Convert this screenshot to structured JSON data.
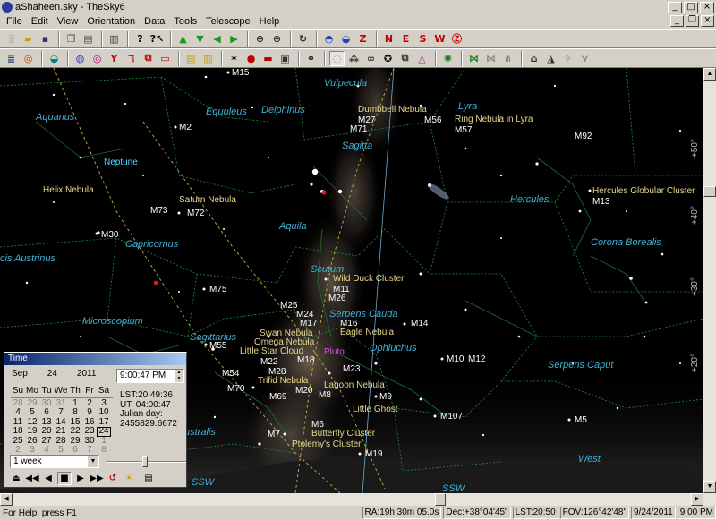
{
  "window": {
    "title": "aShaheen.sky - TheSky6"
  },
  "menu": [
    "File",
    "Edit",
    "View",
    "Orientation",
    "Data",
    "Tools",
    "Telescope",
    "Help"
  ],
  "toolbar1": [
    "📄",
    "📂",
    "💾",
    "▭",
    "▯",
    "🖶",
    "?",
    "?¶",
    "▲",
    "▼",
    "◀",
    "▶",
    "⊕",
    "⊖",
    "↻",
    "⛯",
    "⛰",
    "Z",
    "N",
    "E",
    "S",
    "W",
    "Z"
  ],
  "toolbar2": [
    "≣",
    "⊙",
    "◒",
    "◍",
    "◎",
    "Y",
    "ℸ",
    "□",
    "▤",
    "▥",
    "✶",
    "●",
    "▬",
    "⚭",
    "◌",
    "⁂",
    "∞",
    "✦",
    "⧉",
    "◬",
    "✺",
    "⋈",
    "⋔",
    "⌂",
    "◮",
    "✧",
    "⋎"
  ],
  "sky": {
    "constellations": [
      "Vulpecula",
      "Lyra",
      "Equuleus",
      "Delphinus",
      "Aquarius",
      "Sagitta",
      "Hercules",
      "Aquila",
      "Capricornus",
      "Corona Borealis",
      "cis Austrinus",
      "Scutum",
      "Serpens Cauda",
      "Microscopium",
      "Ophiuchus",
      "Sagittarius",
      "Serpens Caput",
      "ustralis"
    ],
    "objects": [
      "Dumbbell Nebula",
      "Ring Nebula in Lyra",
      "Helix Nebula",
      "Saturn Nebula",
      "Hercules Globular Cluster",
      "Wild Duck Cluster",
      "Eagle Nebula",
      "Swan Nebula",
      "Omega Nebula",
      "Little Star Cloud",
      "Trifid Nebula",
      "Lagoon Nebula",
      "Little Ghost",
      "Butterfly Cluster",
      "Ptolemy's Cluster"
    ],
    "messier": [
      "M15",
      "M2",
      "M27",
      "M56",
      "M71",
      "M57",
      "M92",
      "M73",
      "M72",
      "M30",
      "M13",
      "M75",
      "M11",
      "M26",
      "M25",
      "M24",
      "M17",
      "M16",
      "M14",
      "M55",
      "M18",
      "M23",
      "M22",
      "M28",
      "M10",
      "M12",
      "M54",
      "M20",
      "M8",
      "M70",
      "M69",
      "M9",
      "M107",
      "M7",
      "M6",
      "M5",
      "M19"
    ],
    "planets": [
      "Neptune",
      "Pluto"
    ],
    "directions": [
      "SSW",
      "SSW",
      "West"
    ],
    "altitudes": [
      "+50°",
      "+40°",
      "+30°",
      "+20°"
    ]
  },
  "time_window": {
    "title": "Time",
    "month": "Sep",
    "day": "24",
    "year": "2011",
    "weekdays": [
      "Su",
      "Mo",
      "Tu",
      "We",
      "Th",
      "Fr",
      "Sa"
    ],
    "weeks": [
      [
        "28",
        "29",
        "30",
        "31",
        "1",
        "2",
        "3"
      ],
      [
        "4",
        "5",
        "6",
        "7",
        "8",
        "9",
        "10"
      ],
      [
        "11",
        "12",
        "13",
        "14",
        "15",
        "16",
        "17"
      ],
      [
        "18",
        "19",
        "20",
        "21",
        "22",
        "23",
        "24"
      ],
      [
        "25",
        "26",
        "27",
        "28",
        "29",
        "30",
        "1"
      ],
      [
        "2",
        "3",
        "4",
        "5",
        "6",
        "7",
        "8"
      ]
    ],
    "time": "9:00:47 PM",
    "lst": "LST:20:49:36",
    "ut": "UT: 04:00:47",
    "julian_label": "Julian day:",
    "julian": "2455829.6672",
    "step": "1 week"
  },
  "status": {
    "help": "For Help, press F1",
    "ra": "RA:19h 30m 05.0s",
    "dec": "Dec:+38°04'45\"",
    "lst": "LST:20:50",
    "fov": "FOV:126°42'48\"",
    "date": "9/24/2011",
    "time": "9:00 PM"
  }
}
